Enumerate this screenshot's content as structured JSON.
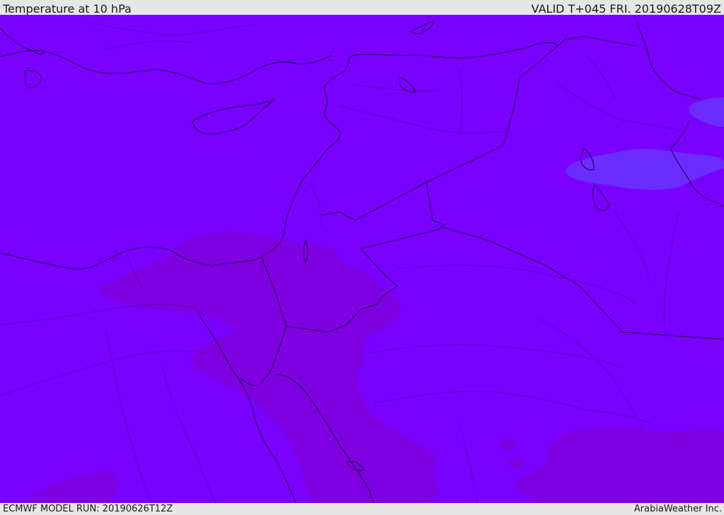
{
  "header": {
    "title": "Temperature at 10 hPa",
    "valid": "VALID T+045 FRI. 20190628T09Z"
  },
  "footer": {
    "model_run": "ECMWF MODEL RUN: 20190626T12Z",
    "credit": "ArabiaWeather Inc."
  },
  "colors": {
    "base_fill": "#7a00ff",
    "warm_band": "#7f00e0",
    "cool_patch": "#6a2cff",
    "coastline": "#1a0040",
    "borders": "#3a0070"
  }
}
